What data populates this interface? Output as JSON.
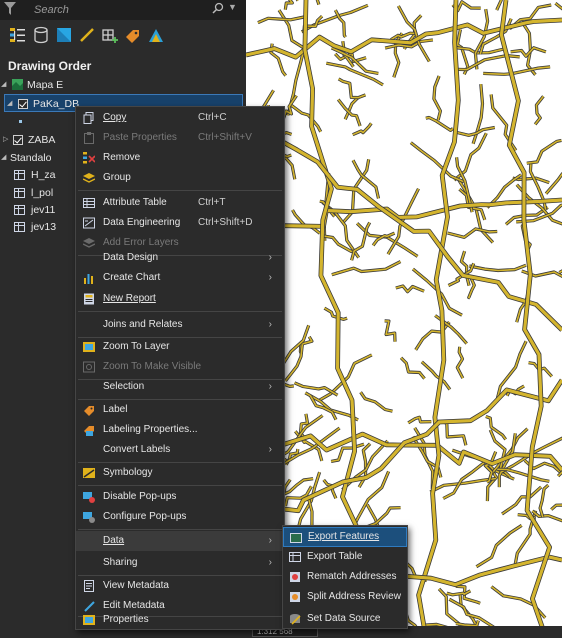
{
  "contents": {
    "search_placeholder": "Search",
    "title": "Drawing Order",
    "tree": {
      "map": "Mapa E",
      "group_layer": "PaKa_DB",
      "group_layer2": "ZABA",
      "standalone": "Standalo",
      "tables": [
        "H_za",
        "l_pol",
        "jev11",
        "jev13"
      ]
    }
  },
  "status": {
    "scale": "1:312 568"
  },
  "context_menu": {
    "items": [
      {
        "label": "Copy",
        "shortcut": "Ctrl+C",
        "icon": "copy-icon"
      },
      {
        "label": "Paste Properties",
        "shortcut": "Ctrl+Shift+V",
        "icon": "paste-icon",
        "disabled": true
      },
      {
        "label": "Remove",
        "icon": "remove-icon"
      },
      {
        "label": "Group",
        "icon": "group-icon"
      },
      {
        "label": "Attribute Table",
        "shortcut": "Ctrl+T",
        "icon": "attribute-table-icon"
      },
      {
        "label": "Data Engineering",
        "shortcut": "Ctrl+Shift+D",
        "icon": "data-engineering-icon"
      },
      {
        "label": "Add Error Layers",
        "icon": "error-layers-icon",
        "disabled": true
      },
      {
        "label": "Data Design"
      },
      {
        "label": "Create Chart",
        "icon": "chart-icon"
      },
      {
        "label": "New Report",
        "icon": "report-icon"
      },
      {
        "label": "Joins and Relates"
      },
      {
        "label": "Zoom To Layer",
        "icon": "zoom-layer-icon"
      },
      {
        "label": "Zoom To Make Visible",
        "icon": "zoom-visible-icon",
        "disabled": true
      },
      {
        "label": "Selection"
      },
      {
        "label": "Label",
        "icon": "label-icon"
      },
      {
        "label": "Labeling Properties...",
        "icon": "labeling-properties-icon"
      },
      {
        "label": "Convert Labels"
      },
      {
        "label": "Symbology",
        "icon": "symbology-icon"
      },
      {
        "label": "Disable Pop-ups",
        "icon": "disable-popups-icon"
      },
      {
        "label": "Configure Pop-ups",
        "icon": "configure-popups-icon"
      },
      {
        "label": "Data"
      },
      {
        "label": "Sharing"
      },
      {
        "label": "View Metadata",
        "icon": "view-metadata-icon"
      },
      {
        "label": "Edit Metadata",
        "icon": "edit-metadata-icon"
      },
      {
        "label": "Properties",
        "icon": "properties-icon"
      }
    ]
  },
  "data_submenu": {
    "items": [
      {
        "label": "Export Features",
        "icon": "export-features-icon"
      },
      {
        "label": "Export Table",
        "icon": "export-table-icon"
      },
      {
        "label": "Rematch Addresses",
        "icon": "rematch-icon"
      },
      {
        "label": "Split Address Review",
        "icon": "split-review-icon"
      },
      {
        "label": "Set Data Source",
        "icon": "set-source-icon"
      }
    ]
  },
  "colors": {
    "road": "#d4b52e",
    "accent": "#1c4f7c",
    "pane": "#2b2b2b"
  }
}
